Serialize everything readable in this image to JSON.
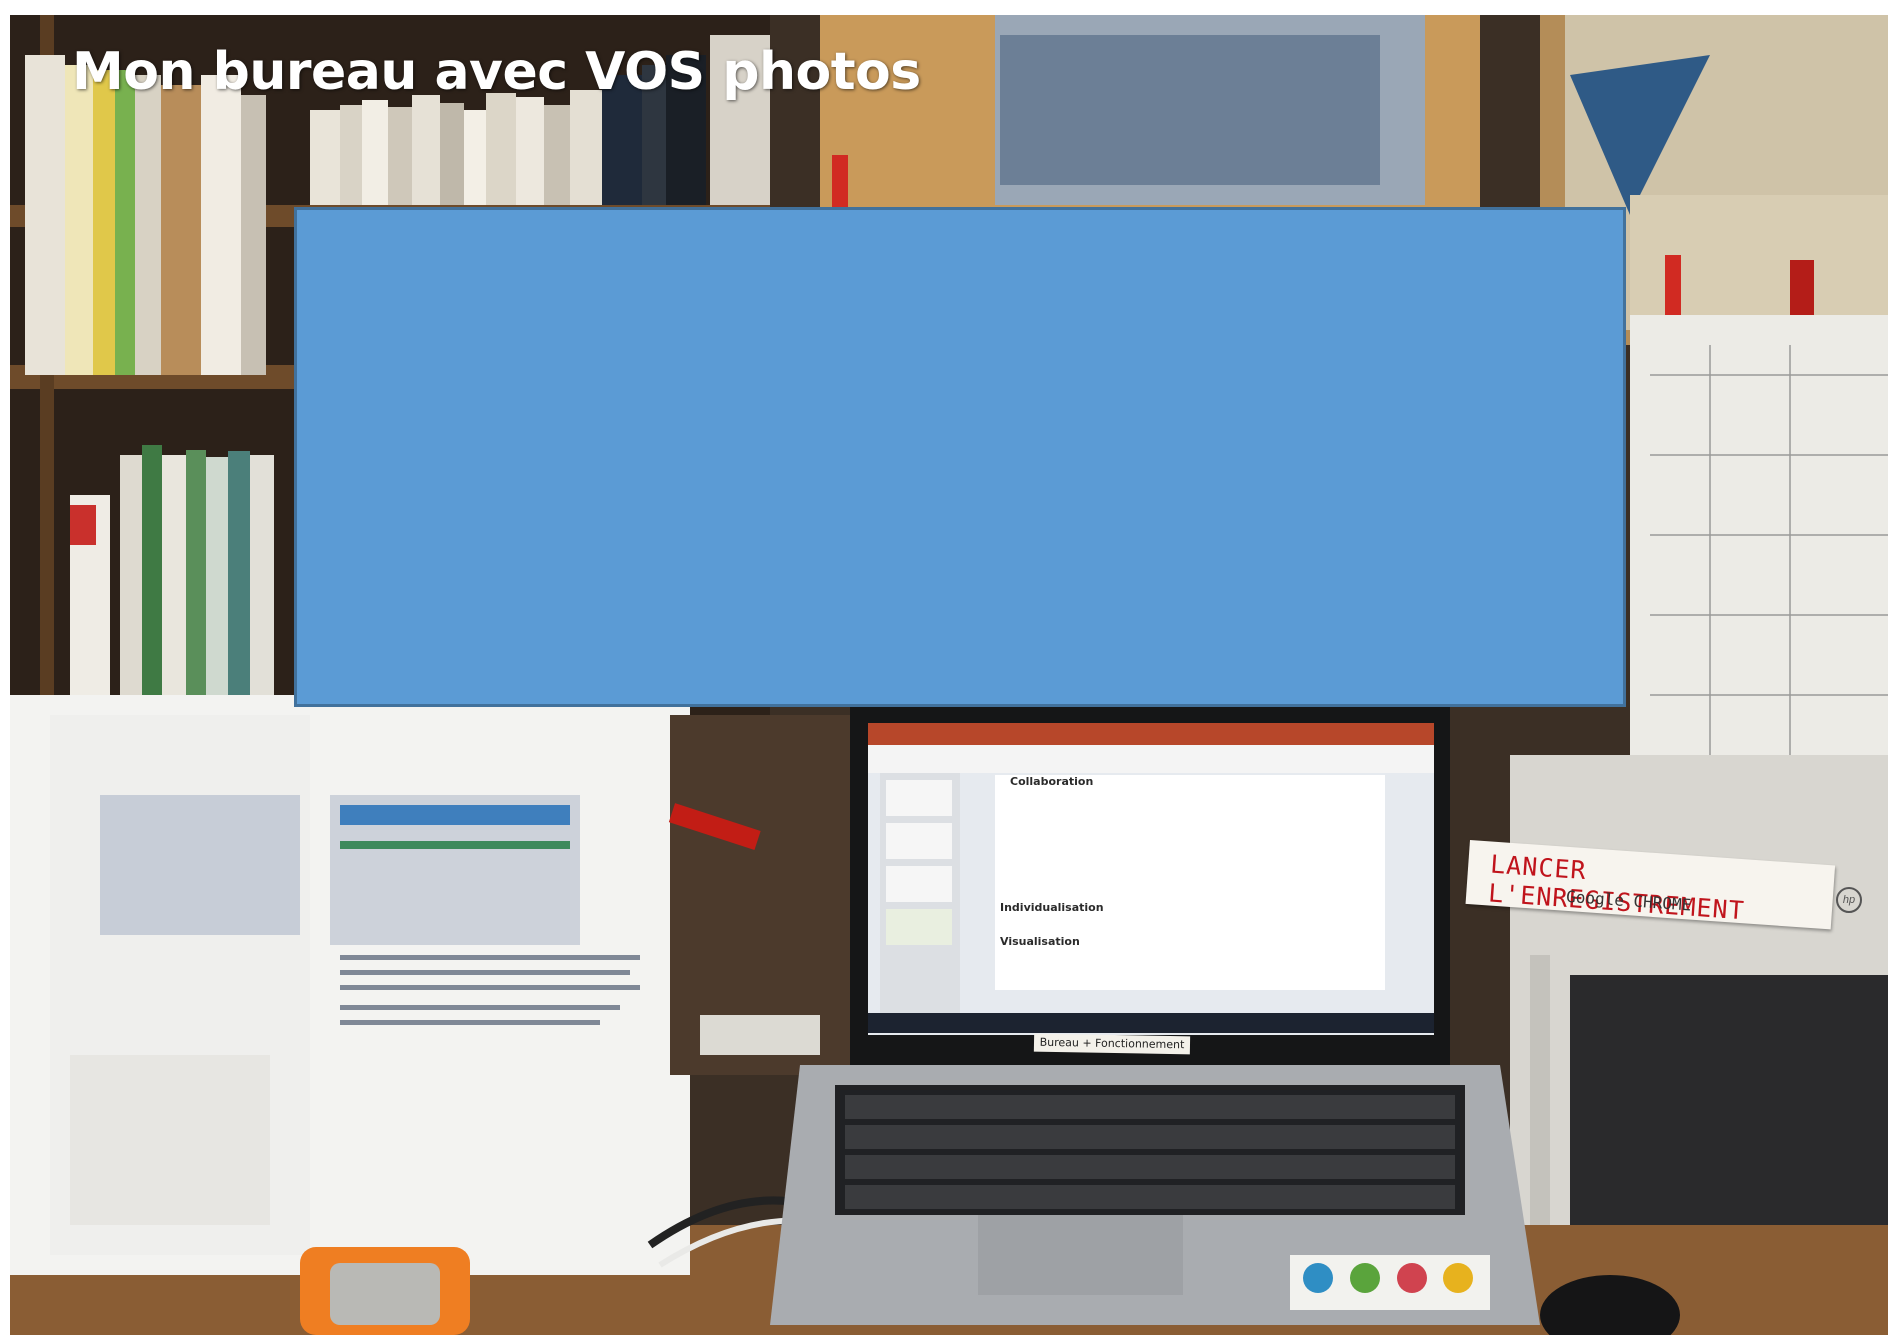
{
  "slide": {
    "title": "Mon bureau avec VOS photos"
  },
  "photo": {
    "sticky_note_line1": "LANCER L'ENREGISTREMENT",
    "sticky_note_line2": "Google CHROME",
    "laptop_slide_headings": [
      "Collaboration",
      "Individualisation",
      "Visualisation"
    ],
    "laptop_label": "Bureau + Fonctionnement",
    "printer_logo": "hp"
  },
  "colors": {
    "overlay_fill": "#5b9bd5",
    "overlay_border": "#41719c",
    "title_text": "#ffffff",
    "note_ink": "#c0141c"
  }
}
